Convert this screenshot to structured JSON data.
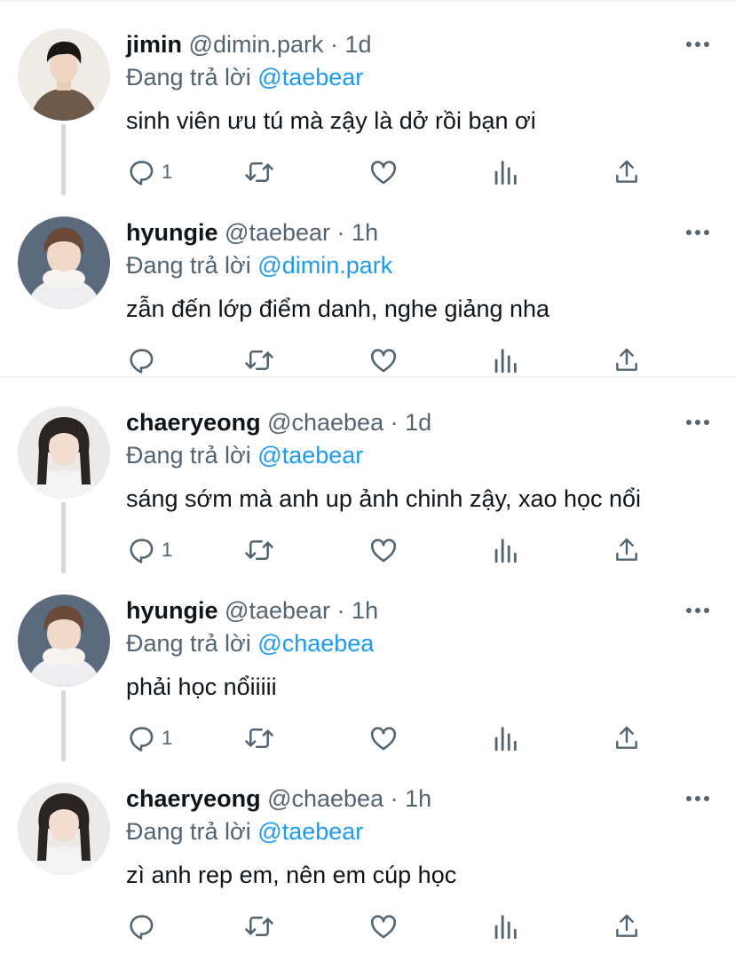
{
  "colors": {
    "text": "#0f1419",
    "secondary": "#536471",
    "mention": "#1d9bf0",
    "thread_line": "#cfd9de",
    "divider": "#eff3f4"
  },
  "icons": {
    "reply": "reply-icon",
    "retweet": "retweet-icon",
    "like": "like-icon",
    "views": "views-icon",
    "share": "share-icon",
    "more": "more-icon"
  },
  "replying_label": "Đang trả lời",
  "dot": "·",
  "tweets": [
    {
      "name": "jimin",
      "handle": "@dimin.park",
      "time": "1d",
      "reply_to": "@taebear",
      "text": "sinh viên ưu tú mà zậy là dở rồi bạn ơi",
      "reply_count": "1"
    },
    {
      "name": "hyungie",
      "handle": "@taebear",
      "time": "1h",
      "reply_to": "@dimin.park",
      "text": "zẫn đến lớp điểm danh, nghe giảng nha",
      "reply_count": ""
    },
    {
      "name": "chaeryeong",
      "handle": "@chaebea",
      "time": "1d",
      "reply_to": "@taebear",
      "text": "sáng sớm mà anh up ảnh chinh zậy, xao học nổi",
      "reply_count": "1"
    },
    {
      "name": "hyungie",
      "handle": "@taebear",
      "time": "1h",
      "reply_to": "@chaebea",
      "text": "phải học nổiiiii",
      "reply_count": "1"
    },
    {
      "name": "chaeryeong",
      "handle": "@chaebea",
      "time": "1h",
      "reply_to": "@taebear",
      "text": "zì anh rep em, nên em cúp học",
      "reply_count": ""
    }
  ]
}
